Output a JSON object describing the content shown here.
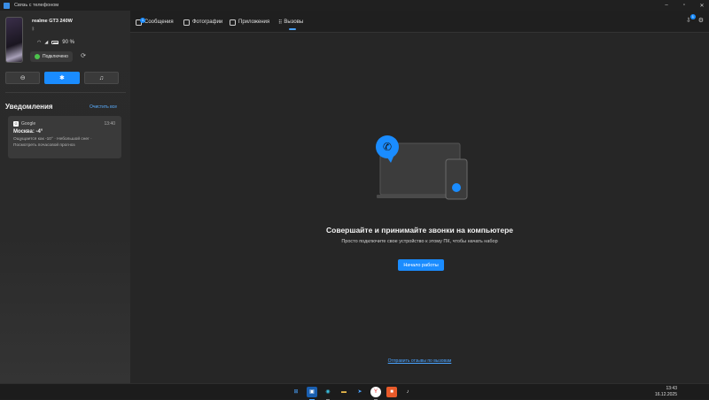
{
  "window": {
    "title": "Связь с телефоном",
    "minimize": "–",
    "maximize": "▫",
    "close": "✕"
  },
  "device": {
    "name": "realme GT3 240W",
    "battery": "90 %",
    "connection_status": "Подключено"
  },
  "mode_buttons": [
    {
      "icon": "minus-circle-icon"
    },
    {
      "icon": "bluetooth-icon",
      "active": true
    },
    {
      "icon": "music-note-icon"
    }
  ],
  "notifications": {
    "title": "Уведомления",
    "clear_all": "Очистить все",
    "items": [
      {
        "app": "Google",
        "time": "13:40",
        "headline": "Москва: -4°",
        "line1": "Ощущается как -10° · Небольшой снег ·",
        "line2": "Посмотреть почасовой прогноз"
      }
    ]
  },
  "tabs": [
    {
      "label": "Сообщения",
      "badge": "1"
    },
    {
      "label": "Фотографии"
    },
    {
      "label": "Приложения"
    },
    {
      "label": "Вызовы",
      "active": true
    }
  ],
  "main": {
    "heading": "Совершайте и принимайте звонки на компьютере",
    "subtitle": "Просто подключите свое устройство к этому ПК, чтобы начать набор",
    "start_button": "Начало работы",
    "footer_link": "Отправить отзывы по вызовам"
  },
  "taskbar": {
    "time": "13:43",
    "date": "16.12.2025",
    "phone_badge": "1"
  },
  "colors": {
    "accent": "#1a8cff",
    "connected_dot": "#4cc24c"
  }
}
